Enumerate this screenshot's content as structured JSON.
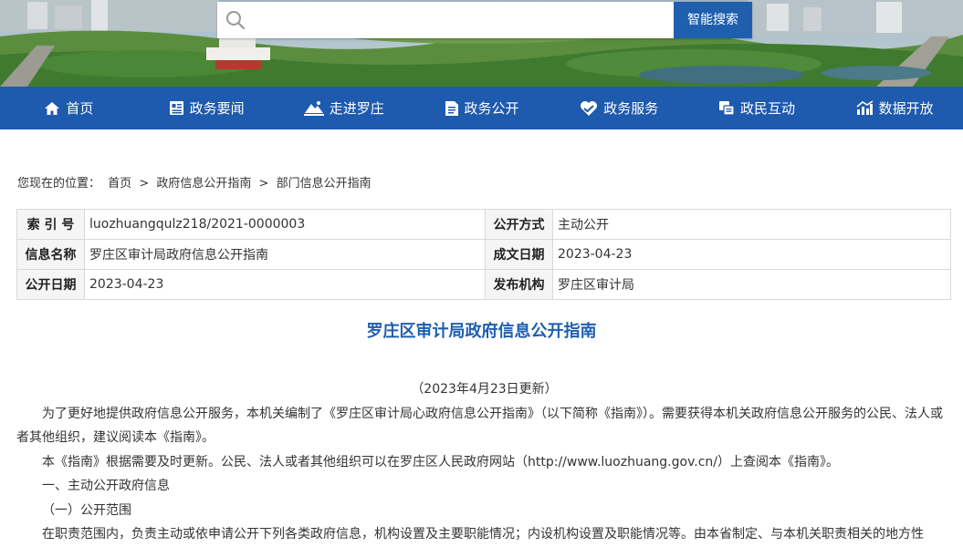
{
  "search": {
    "placeholder": "",
    "button_label": "智能搜索"
  },
  "nav": {
    "items": [
      {
        "label": "首页",
        "icon": "home-icon"
      },
      {
        "label": "政务要闻",
        "icon": "news-icon"
      },
      {
        "label": "走进罗庄",
        "icon": "landscape-icon"
      },
      {
        "label": "政务公开",
        "icon": "document-icon"
      },
      {
        "label": "政务服务",
        "icon": "heart-icon"
      },
      {
        "label": "政民互动",
        "icon": "chat-icon"
      },
      {
        "label": "数据开放",
        "icon": "chart-icon"
      }
    ]
  },
  "breadcrumb": {
    "prefix": "您现在的位置：",
    "items": [
      "首页",
      "政府信息公开指南",
      "部门信息公开指南"
    ],
    "separator": ">"
  },
  "info": {
    "rows": [
      {
        "label1": "索 引 号",
        "value1": "luozhuangqulz218/2021-0000003",
        "label2": "公开方式",
        "value2": "主动公开"
      },
      {
        "label1": "信息名称",
        "value1": "罗庄区审计局政府信息公开指南",
        "label2": "成文日期",
        "value2": "2023-04-23"
      },
      {
        "label1": "公开日期",
        "value1": "2023-04-23",
        "label2": "发布机构",
        "value2": "罗庄区审计局"
      }
    ]
  },
  "article": {
    "title": "罗庄区审计局政府信息公开指南",
    "update_note": "（2023年4月23日更新）",
    "para1": "为了更好地提供政府信息公开服务，本机关编制了《罗庄区审计局心政府信息公开指南》（以下简称《指南》）。需要获得本机关政府信息公开服务的公民、法人或者其他组织，建议阅读本《指南》。",
    "para2": "本《指南》根据需要及时更新。公民、法人或者其他组织可以在罗庄区人民政府网站（http://www.luozhuang.gov.cn/）上查阅本《指南》。",
    "section1": "一、主动公开政府信息",
    "subsection1": "（一）公开范围",
    "para3": "在职责范围内，负责主动或依申请公开下列各类政府信息，机构设置及主要职能情况；内设机构设置及职能情况等。由本省制定、与本机关职责相关的地方性"
  },
  "colors": {
    "brand_blue": "#1e5aad",
    "title_blue": "#1f5fae"
  }
}
